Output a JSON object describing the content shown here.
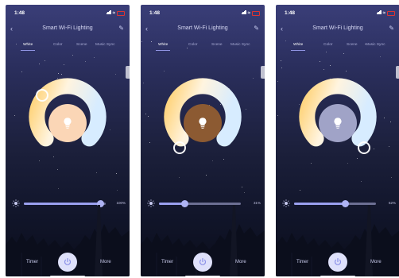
{
  "status_bar": {
    "time": "1:48"
  },
  "header": {
    "title": "Smart Wi-Fi Lighting"
  },
  "tabs": [
    "White",
    "Color",
    "Scene",
    "Music Sync"
  ],
  "bottom": {
    "timer_label": "Timer",
    "more_label": "More"
  },
  "icons": {
    "back": "back-chevron-icon",
    "edit": "edit-pen-icon",
    "bulb": "bulb-icon",
    "sun": "brightness-sun-icon",
    "power": "power-icon"
  },
  "colors": {
    "accent": "#9aa0ef",
    "warm_white": "#ffe2a0",
    "cool_white": "#e6f4ff",
    "background_top": "#3a3e78",
    "background_bottom": "#0a0d1a"
  },
  "screens": [
    {
      "brightness_text": "100%",
      "brightness_level": 0.93,
      "bulb_color": "#fbd6b6",
      "knob_position": "upper-left"
    },
    {
      "brightness_text": "31%",
      "brightness_level": 0.31,
      "bulb_color": "#8c5a32",
      "knob_position": "bottom-left"
    },
    {
      "brightness_text": "62%",
      "brightness_level": 0.62,
      "bulb_color": "#a0a3c7",
      "knob_position": "bottom-right"
    }
  ]
}
